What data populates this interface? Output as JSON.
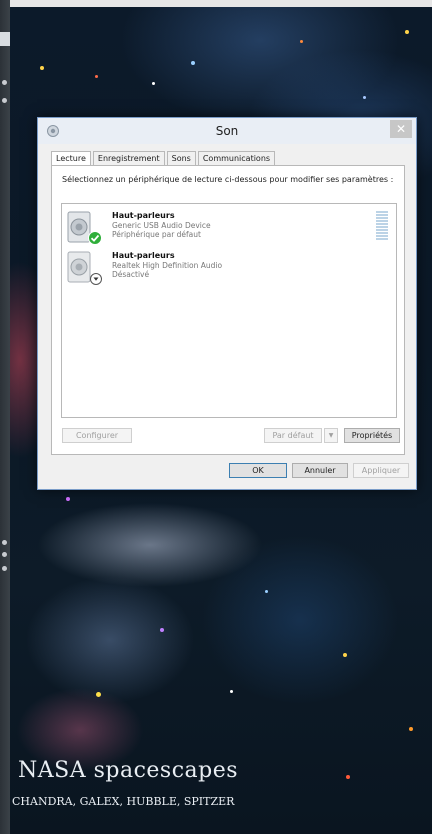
{
  "dialog": {
    "title": "Son",
    "close_label": "✕",
    "tabs": [
      {
        "label": "Lecture"
      },
      {
        "label": "Enregistrement"
      },
      {
        "label": "Sons"
      },
      {
        "label": "Communications"
      }
    ],
    "instruction": "Sélectionnez un périphérique de lecture ci-dessous pour modifier ses paramètres :",
    "devices": [
      {
        "name": "Haut-parleurs",
        "driver": "Generic USB Audio Device",
        "status": "Périphérique par défaut",
        "status_icon": "check-icon",
        "accent": "#2fae3a"
      },
      {
        "name": "Haut-parleurs",
        "driver": "Realtek High Definition Audio",
        "status": "Désactivé",
        "status_icon": "disabled-arrow-icon"
      }
    ],
    "buttons": {
      "configure": "Configurer",
      "set_default": "Par défaut",
      "dropdown": "▼",
      "properties": "Propriétés",
      "ok": "OK",
      "cancel": "Annuler",
      "apply": "Appliquer"
    }
  },
  "wallpaper": {
    "caption_title": "NASA spacescapes",
    "caption_subtitle": "CHANDRA, GALEX, HUBBLE, SPITZER"
  }
}
